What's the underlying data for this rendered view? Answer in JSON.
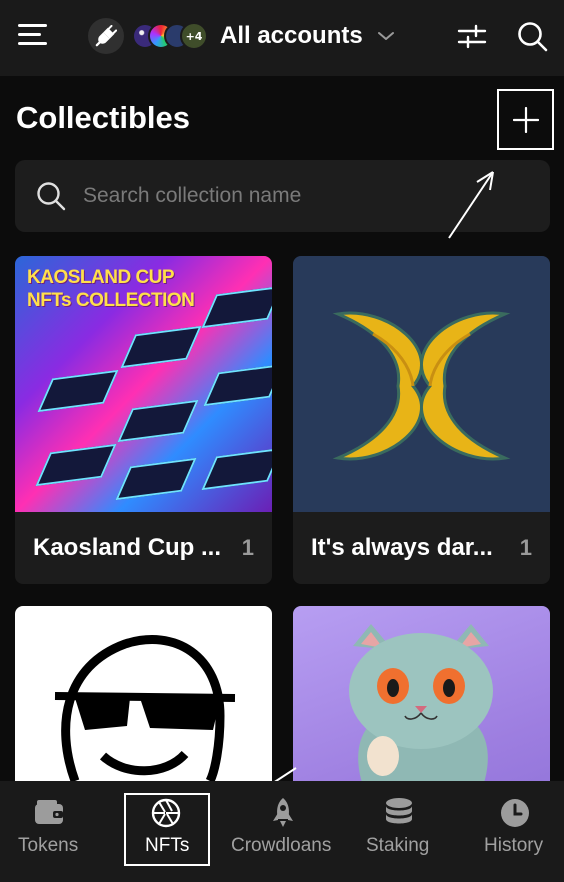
{
  "header": {
    "account_label": "All accounts",
    "avatar_overflow_badge": "+4",
    "icons": [
      "menu-icon",
      "plug-icon",
      "chevron-down-icon",
      "sliders-icon",
      "search-icon"
    ]
  },
  "page": {
    "title": "Collectibles"
  },
  "search": {
    "placeholder": "Search collection name"
  },
  "collections": [
    {
      "name": "Kaosland Cup ...",
      "count": "1",
      "image_text": [
        "KAOSLAND CUP",
        "NFTs COLLECTION"
      ]
    },
    {
      "name": "It's always dar...",
      "count": "1"
    },
    {
      "name": "",
      "count": ""
    },
    {
      "name": "",
      "count": ""
    }
  ],
  "nav": {
    "tabs": [
      {
        "label": "Tokens",
        "icon": "wallet-icon"
      },
      {
        "label": "NFTs",
        "icon": "aperture-icon",
        "active": true
      },
      {
        "label": "Crowdloans",
        "icon": "rocket-icon"
      },
      {
        "label": "Staking",
        "icon": "database-stack-icon"
      },
      {
        "label": "History",
        "icon": "clock-icon"
      }
    ]
  },
  "colors": {
    "background": "#0c0c0c",
    "header": "#1a1a1a",
    "surface": "#1d1d1d",
    "text": "#ffffff",
    "muted": "#a0a0a0"
  }
}
